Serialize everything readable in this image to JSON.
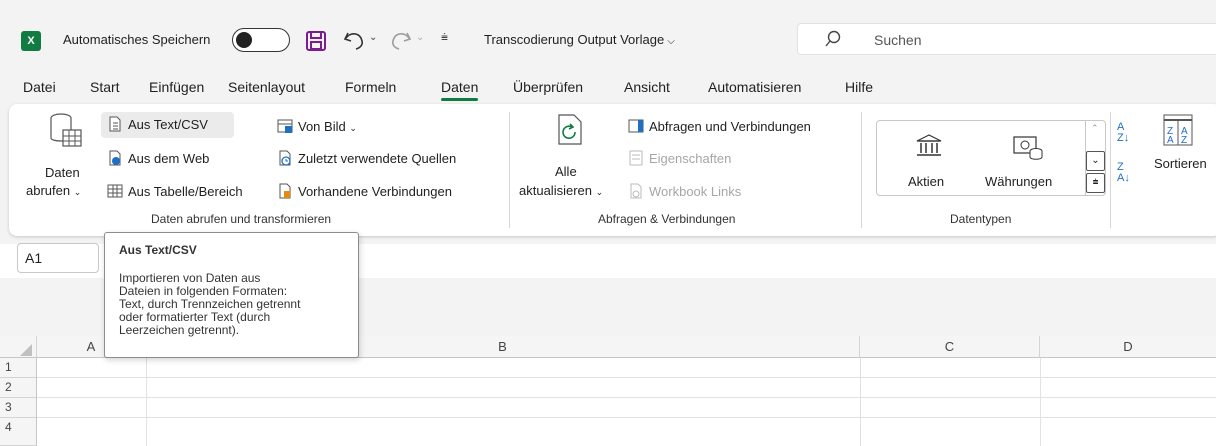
{
  "app": {
    "logo": "X"
  },
  "titlebar": {
    "autosave_label": "Automatisches Speichern",
    "autosave_state": "off",
    "document_title": "Transcodierung Output Vorlage",
    "search_placeholder": "Suchen"
  },
  "menu": {
    "tabs": [
      "Datei",
      "Start",
      "Einfügen",
      "Seitenlayout",
      "Formeln",
      "Daten",
      "Überprüfen",
      "Ansicht",
      "Automatisieren",
      "Hilfe"
    ],
    "active": "Daten"
  },
  "ribbon": {
    "group1": {
      "big_button_line1": "Daten",
      "big_button_line2": "abrufen",
      "aus_text_csv": "Aus Text/CSV",
      "aus_dem_web": "Aus dem Web",
      "aus_tabelle": "Aus Tabelle/Bereich",
      "von_bild": "Von Bild",
      "zuletzt": "Zuletzt verwendete Quellen",
      "vorhandene": "Vorhandene Verbindungen",
      "label": "Daten abrufen und transformieren"
    },
    "group2": {
      "alle_line1": "Alle",
      "alle_line2": "aktualisieren",
      "abfragen": "Abfragen und Verbindungen",
      "eigenschaften": "Eigenschaften",
      "workbook_links": "Workbook Links",
      "label": "Abfragen & Verbindungen"
    },
    "group3": {
      "aktien": "Aktien",
      "waehrungen": "Währungen",
      "label": "Datentypen"
    },
    "group4": {
      "sortieren": "Sortieren"
    }
  },
  "formula": {
    "namebox": "A1"
  },
  "grid": {
    "columns": [
      "A",
      "B",
      "C",
      "D"
    ],
    "rows": [
      "1",
      "2",
      "3",
      "4"
    ]
  },
  "tooltip": {
    "title": "Aus Text/CSV",
    "lines": [
      "Importieren von Daten aus",
      "Dateien in folgenden Formaten:",
      "Text, durch Trennzeichen getrennt",
      "oder formatierter Text (durch",
      "Leerzeichen getrennt)."
    ]
  },
  "colors": {
    "accent": "#107c41"
  }
}
